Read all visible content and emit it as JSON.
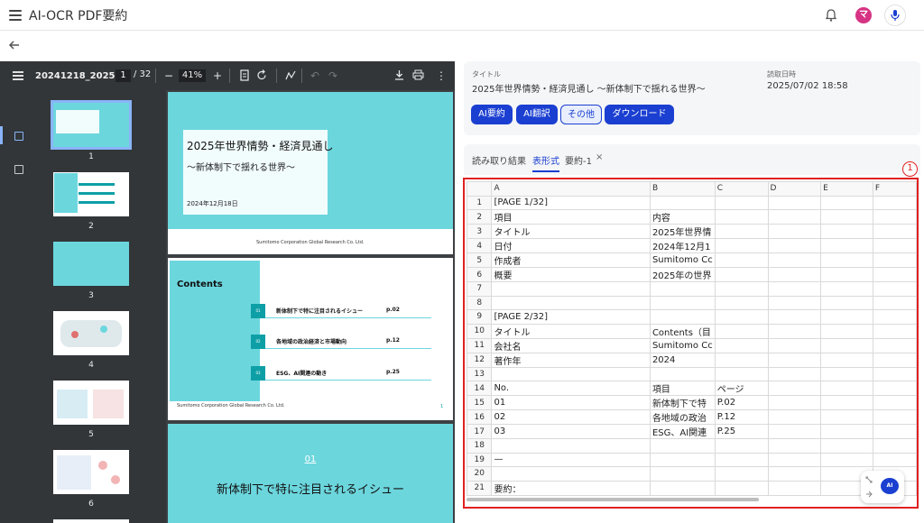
{
  "app": {
    "title": "AI-OCR PDF要約",
    "avatar_initial": "マ"
  },
  "viewer": {
    "filename": "20241218_2025...",
    "current_page": "1",
    "total_pages": "/ 32",
    "zoom": "41%",
    "thumbnails": [
      "1",
      "2",
      "3",
      "4",
      "5",
      "6"
    ],
    "page1": {
      "title": "2025年世界情勢・経済見通し",
      "subtitle": "〜新体制下で揺れる世界〜",
      "date": "2024年12月18日",
      "corp": "Sumitomo Corporation Global Research Co. Ltd."
    },
    "page2": {
      "heading": "Contents",
      "items": [
        {
          "num": "01",
          "text": "新体制下で特に注目されるイシュー",
          "page": "p.02"
        },
        {
          "num": "02",
          "text": "各地域の政治経済と市場動向",
          "page": "p.12"
        },
        {
          "num": "03",
          "text": "ESG、AI関連の動き",
          "page": "p.25"
        }
      ],
      "corp": "Sumitomo Corporation Global Research Co. Ltd.",
      "page_no": "1"
    },
    "page3": {
      "num": "01",
      "title": "新体制下で特に注目されるイシュー"
    }
  },
  "info": {
    "title_label": "タイトル",
    "title_value": "2025年世界情勢・経済見通し 〜新体制下で揺れる世界〜",
    "date_label": "読取日時",
    "date_value": "2025/07/02 18:58",
    "buttons": {
      "summary": "AI要約",
      "translate": "AI翻訳",
      "other": "その他",
      "download": "ダウンロード"
    }
  },
  "tabs": {
    "ocr": "読み取り結果",
    "table": "表形式",
    "summary": "要約-1",
    "close": "×"
  },
  "marker": "1",
  "sheet": {
    "columns": [
      "A",
      "B",
      "C",
      "D",
      "E",
      "F"
    ],
    "rows": [
      [
        "1",
        "[PAGE 1/32]",
        "",
        "",
        "",
        "",
        ""
      ],
      [
        "2",
        "項目",
        "内容",
        "",
        "",
        "",
        ""
      ],
      [
        "3",
        "タイトル",
        "2025年世界情",
        "",
        "",
        "",
        ""
      ],
      [
        "4",
        "日付",
        "2024年12月1",
        "",
        "",
        "",
        ""
      ],
      [
        "5",
        "作成者",
        "Sumitomo Cc",
        "",
        "",
        "",
        ""
      ],
      [
        "6",
        "概要",
        "2025年の世界",
        "",
        "",
        "",
        ""
      ],
      [
        "7",
        "",
        "",
        "",
        "",
        "",
        ""
      ],
      [
        "8",
        "",
        "",
        "",
        "",
        "",
        ""
      ],
      [
        "9",
        "[PAGE 2/32]",
        "",
        "",
        "",
        "",
        ""
      ],
      [
        "10",
        "タイトル",
        "Contents（目",
        "",
        "",
        "",
        ""
      ],
      [
        "11",
        "会社名",
        "Sumitomo Cc",
        "",
        "",
        "",
        ""
      ],
      [
        "12",
        "著作年",
        "2024",
        "",
        "",
        "",
        ""
      ],
      [
        "13",
        "",
        "",
        "",
        "",
        "",
        ""
      ],
      [
        "14",
        "No.",
        "項目",
        "ページ",
        "",
        "",
        ""
      ],
      [
        "15",
        "01",
        "新体制下で特",
        "P.02",
        "",
        "",
        ""
      ],
      [
        "16",
        "02",
        "各地域の政治",
        "P.12",
        "",
        "",
        ""
      ],
      [
        "17",
        "03",
        "ESG、AI関連",
        "P.25",
        "",
        "",
        ""
      ],
      [
        "18",
        "",
        "",
        "",
        "",
        "",
        ""
      ],
      [
        "19",
        "—",
        "",
        "",
        "",
        "",
        ""
      ],
      [
        "20",
        "",
        "",
        "",
        "",
        "",
        ""
      ],
      [
        "21",
        "要約：",
        "",
        "",
        "",
        "",
        ""
      ]
    ]
  },
  "fab": {
    "label": "AI"
  }
}
